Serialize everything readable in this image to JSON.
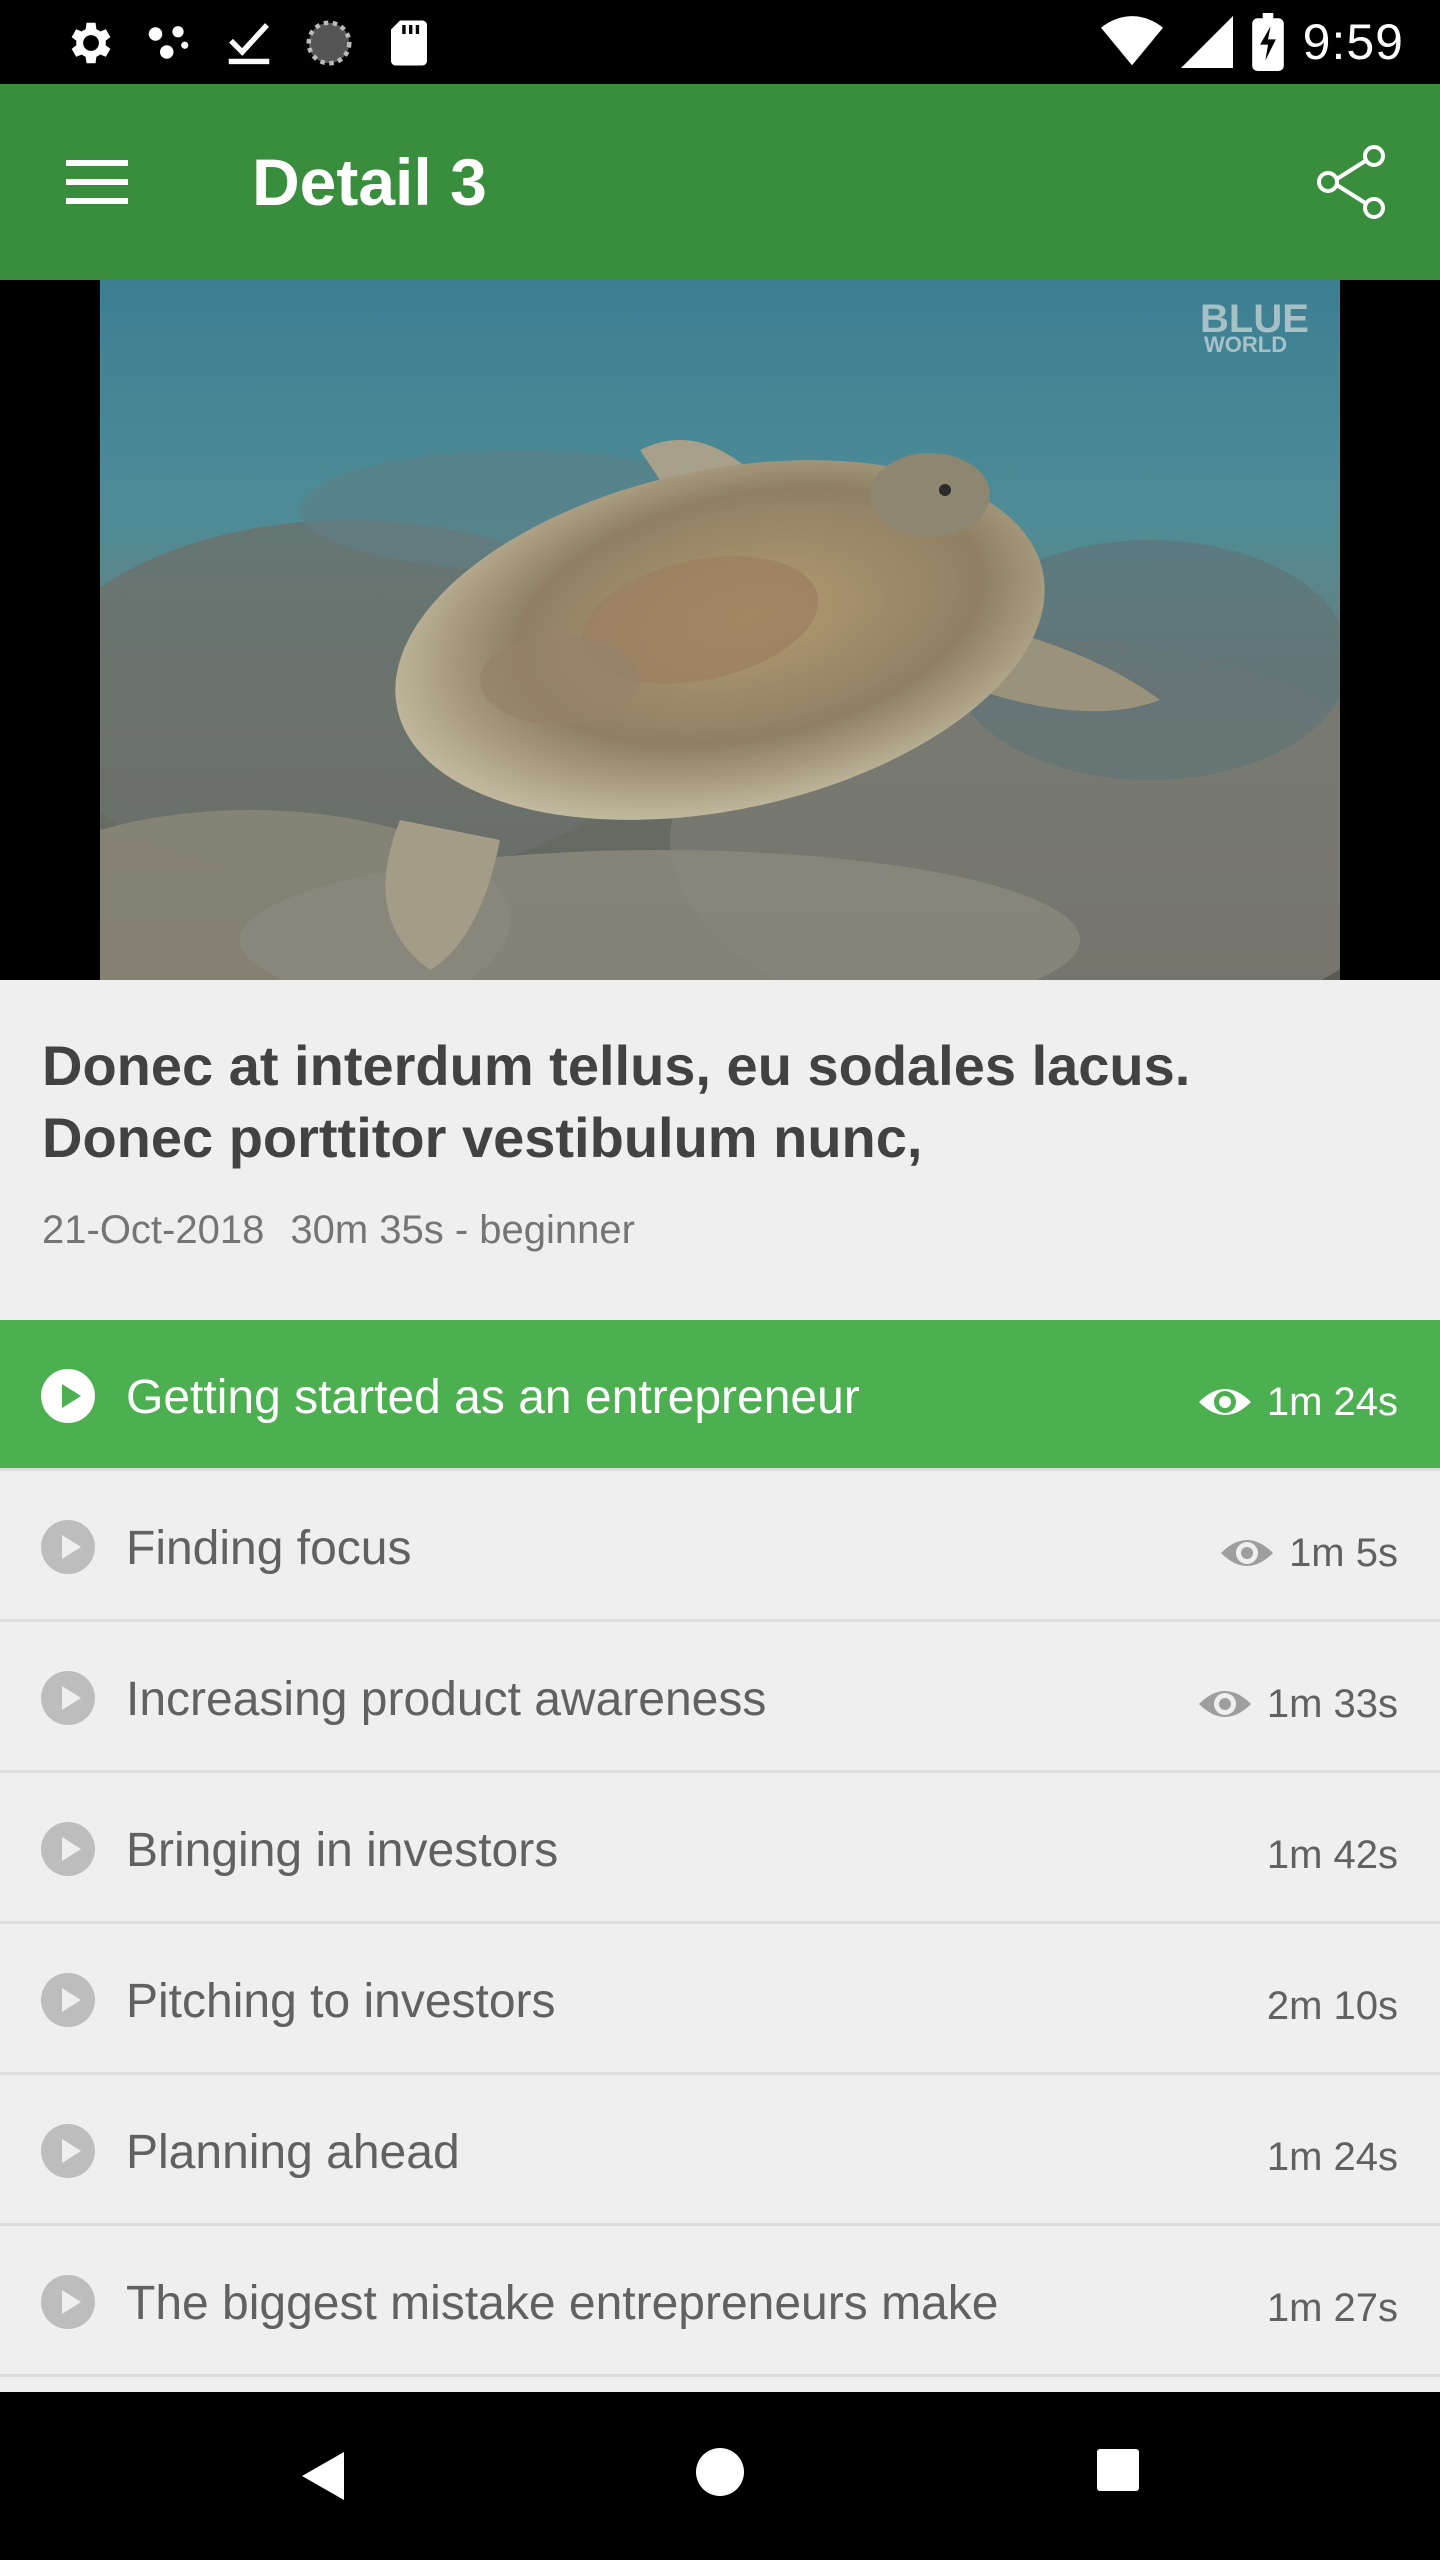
{
  "status_bar": {
    "time": "9:59",
    "left_icons": [
      "settings-icon",
      "dots-icon",
      "download-done-icon",
      "sync-icon",
      "sd-card-icon"
    ],
    "right_icons": [
      "wifi-icon",
      "signal-icon",
      "battery-charging-icon"
    ]
  },
  "app_bar": {
    "title": "Detail 3",
    "menu_icon": "hamburger-menu-icon",
    "share_icon": "share-icon",
    "color": "#388e3c"
  },
  "video": {
    "watermark_line1": "BLUE",
    "watermark_line2": "WORLD"
  },
  "course": {
    "title": "Donec at interdum tellus, eu sodales lacus. Donec porttitor vestibulum nunc,",
    "date": "21-Oct-2018",
    "summary": "30m 35s - beginner"
  },
  "lessons": [
    {
      "title": "Getting started as an entrepreneur",
      "duration": "1m 24s",
      "watched": true,
      "active": true
    },
    {
      "title": "Finding focus",
      "duration": "1m 5s",
      "watched": true,
      "active": false
    },
    {
      "title": "Increasing product awareness",
      "duration": "1m 33s",
      "watched": true,
      "active": false
    },
    {
      "title": "Bringing in investors",
      "duration": "1m 42s",
      "watched": false,
      "active": false
    },
    {
      "title": "Pitching to investors",
      "duration": "2m 10s",
      "watched": false,
      "active": false
    },
    {
      "title": "Planning ahead",
      "duration": "1m 24s",
      "watched": false,
      "active": false
    },
    {
      "title": "The biggest mistake entrepreneurs make",
      "duration": "1m 27s",
      "watched": false,
      "active": false
    }
  ],
  "colors": {
    "active_row": "#4caf50",
    "app_bar": "#388e3c",
    "background": "#efefef"
  },
  "nav_bar": {
    "icons": [
      "back-icon",
      "home-icon",
      "recents-icon"
    ]
  }
}
